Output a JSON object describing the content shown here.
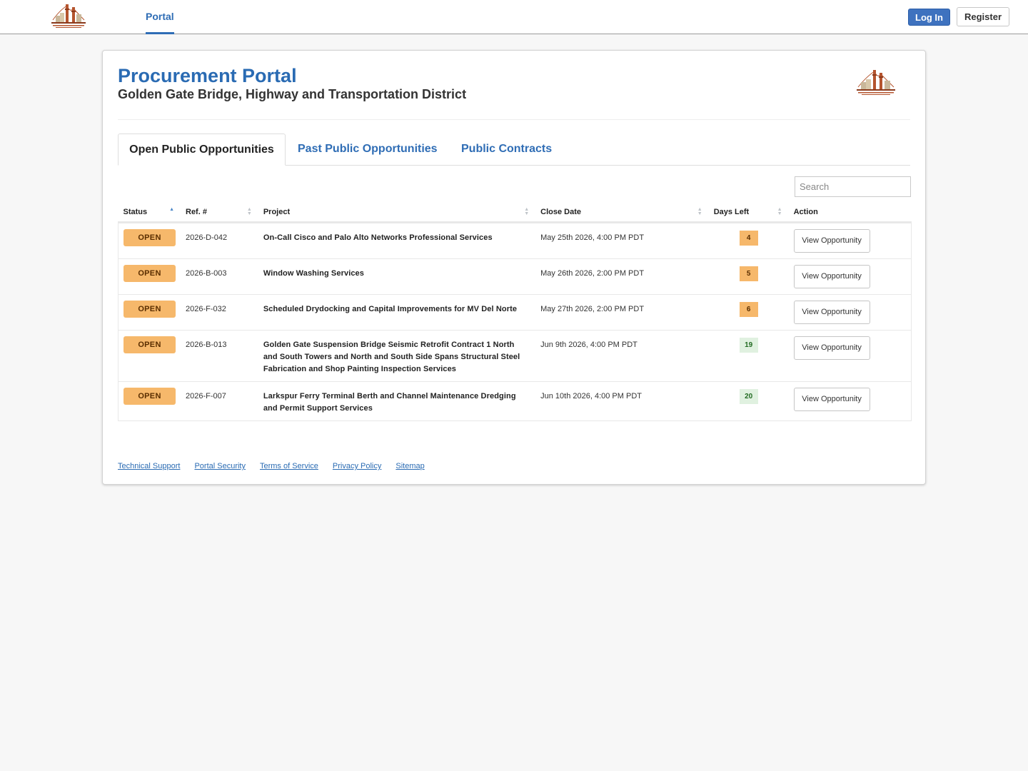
{
  "topnav": {
    "nav_tab": "Portal",
    "login_label": "Log In",
    "register_label": "Register"
  },
  "header": {
    "title": "Procurement Portal",
    "subtitle": "Golden Gate Bridge, Highway and Transportation District"
  },
  "tabs": [
    {
      "label": "Open Public Opportunities",
      "active": true
    },
    {
      "label": "Past Public Opportunities",
      "active": false
    },
    {
      "label": "Public Contracts",
      "active": false
    }
  ],
  "search": {
    "placeholder": "Search",
    "value": ""
  },
  "table": {
    "columns": [
      "Status",
      "Ref. #",
      "Project",
      "Close Date",
      "Days Left",
      "Action"
    ],
    "rows": [
      {
        "status": "OPEN",
        "ref": "2026-D-042",
        "project": "On-Call Cisco and Palo Alto Networks Professional Services",
        "close_date": "May 25th 2026, 4:00 PM PDT",
        "days_left": "4",
        "action": "View Opportunity"
      },
      {
        "status": "OPEN",
        "ref": "2026-B-003",
        "project": "Window Washing Services",
        "close_date": "May 26th 2026, 2:00 PM PDT",
        "days_left": "5",
        "action": "View Opportunity"
      },
      {
        "status": "OPEN",
        "ref": "2026-F-032",
        "project": "Scheduled Drydocking and Capital Improvements for MV Del Norte",
        "close_date": "May 27th 2026, 2:00 PM PDT",
        "days_left": "6",
        "action": "View Opportunity"
      },
      {
        "status": "OPEN",
        "ref": "2026-B-013",
        "project": "Golden Gate Suspension Bridge Seismic Retrofit Contract 1 North and South Towers and North and South Side Spans Structural Steel Fabrication and Shop Painting Inspection Services",
        "close_date": "Jun 9th 2026, 4:00 PM PDT",
        "days_left": "19",
        "action": "View Opportunity"
      },
      {
        "status": "OPEN",
        "ref": "2026-F-007",
        "project": "Larkspur Ferry Terminal Berth and Channel Maintenance Dredging and Permit Support Services",
        "close_date": "Jun 10th 2026, 4:00 PM PDT",
        "days_left": "20",
        "action": "View Opportunity"
      }
    ]
  },
  "footer": {
    "links": [
      "Technical Support",
      "Portal Security",
      "Terms of Service",
      "Privacy Policy",
      "Sitemap"
    ]
  },
  "colors": {
    "accent": "#2f6db5",
    "login_bg": "#3e72bf",
    "open_badge": "#f6b86b",
    "days_warn": "#f6b86b",
    "days_ok": "#e0f1e0"
  }
}
